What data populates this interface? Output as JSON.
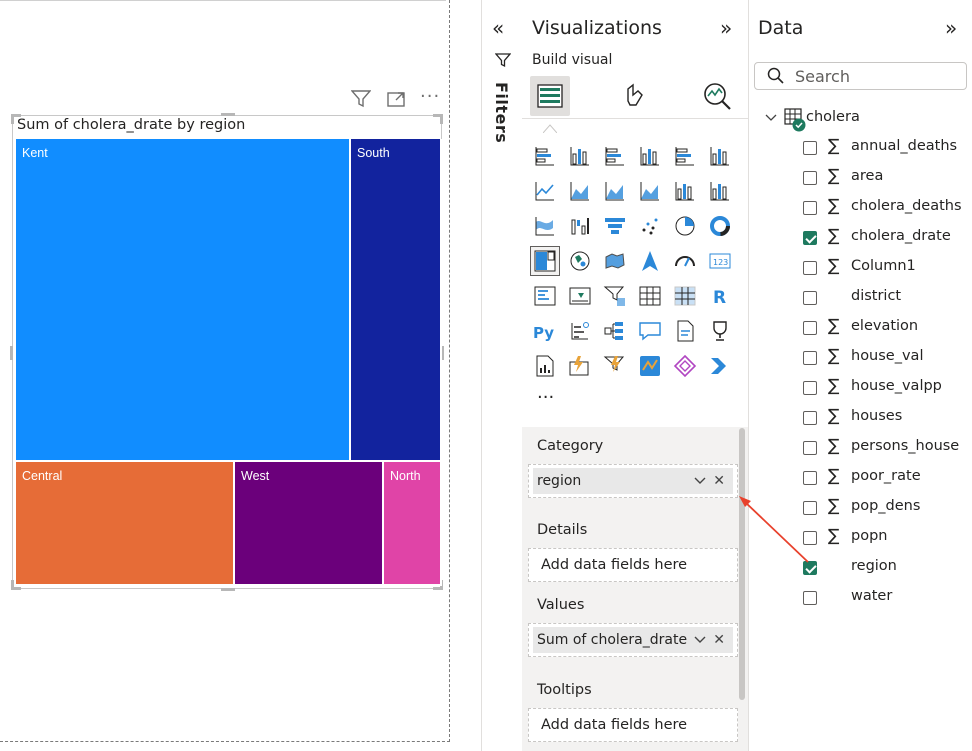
{
  "visual": {
    "title": "Sum of cholera_drate by region"
  },
  "chart_data": {
    "type": "treemap",
    "title": "Sum of cholera_drate by region",
    "tiles": [
      {
        "name": "Kent",
        "color": "#118dff"
      },
      {
        "name": "South",
        "color": "#12239e"
      },
      {
        "name": "Central",
        "color": "#e66c37"
      },
      {
        "name": "West",
        "color": "#6b007b"
      },
      {
        "name": "North",
        "color": "#e044a7"
      }
    ]
  },
  "filters": {
    "label": "Filters"
  },
  "visualizations": {
    "title": "Visualizations",
    "subtitle": "Build visual",
    "wells": {
      "category_label": "Category",
      "category_field": "region",
      "details_label": "Details",
      "details_placeholder": "Add data fields here",
      "values_label": "Values",
      "values_field": "Sum of cholera_drate",
      "tooltips_label": "Tooltips",
      "tooltips_placeholder": "Add data fields here"
    },
    "more": "···"
  },
  "data": {
    "title": "Data",
    "search_placeholder": "Search",
    "table": "cholera",
    "fields": [
      {
        "name": "annual_deaths",
        "sigma": true,
        "checked": false
      },
      {
        "name": "area",
        "sigma": true,
        "checked": false
      },
      {
        "name": "cholera_deaths",
        "sigma": true,
        "checked": false
      },
      {
        "name": "cholera_drate",
        "sigma": true,
        "checked": true
      },
      {
        "name": "Column1",
        "sigma": true,
        "checked": false
      },
      {
        "name": "district",
        "sigma": false,
        "checked": false
      },
      {
        "name": "elevation",
        "sigma": true,
        "checked": false
      },
      {
        "name": "house_val",
        "sigma": true,
        "checked": false
      },
      {
        "name": "house_valpp",
        "sigma": true,
        "checked": false
      },
      {
        "name": "houses",
        "sigma": true,
        "checked": false
      },
      {
        "name": "persons_house",
        "sigma": true,
        "checked": false
      },
      {
        "name": "poor_rate",
        "sigma": true,
        "checked": false
      },
      {
        "name": "pop_dens",
        "sigma": true,
        "checked": false
      },
      {
        "name": "popn",
        "sigma": true,
        "checked": false
      },
      {
        "name": "region",
        "sigma": false,
        "checked": true
      },
      {
        "name": "water",
        "sigma": false,
        "checked": false
      }
    ],
    "sigma_symbol": "∑"
  },
  "colors": {
    "accent": "#1e7a5f",
    "arrow": "#e8412c"
  }
}
